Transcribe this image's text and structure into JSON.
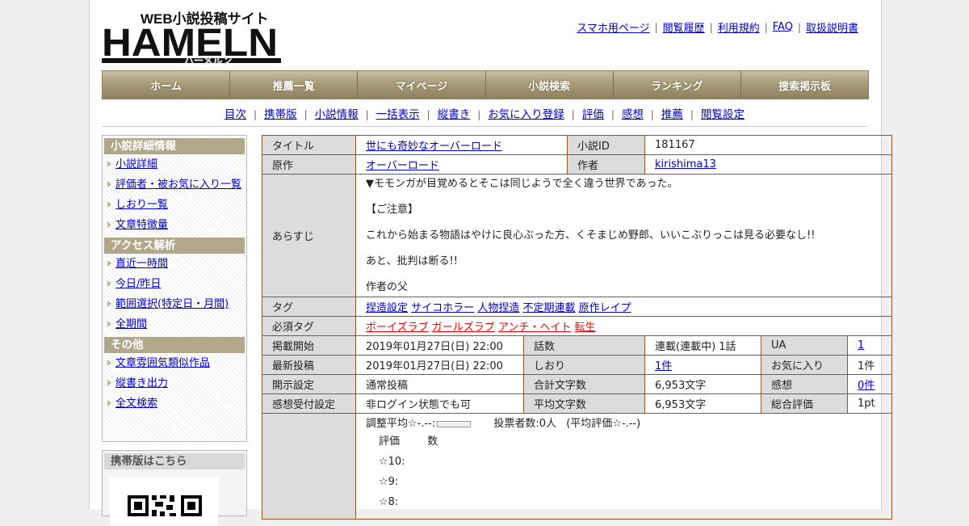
{
  "logo": {
    "main": "HAMELN",
    "tagline": "WEB小説投稿サイト",
    "kana": "ハーメルン"
  },
  "top_links": [
    "スマホ用ページ",
    "閲覧履歴",
    "利用規約",
    "FAQ",
    "取扱説明書"
  ],
  "main_nav": [
    "ホーム",
    "推薦一覧",
    "マイページ",
    "小説検索",
    "ランキング",
    "捜索掲示板"
  ],
  "sub_nav": [
    "目次",
    "携帯版",
    "小説情報",
    "一括表示",
    "縦書き",
    "お気に入り登録",
    "評価",
    "感想",
    "推薦",
    "閲覧設定"
  ],
  "sidebar": {
    "sections": [
      {
        "title": "小説詳細情報",
        "items": [
          "小説詳細",
          "評価者・被お気に入り一覧",
          "しおり一覧",
          "文章特徴量"
        ]
      },
      {
        "title": "アクセス解析",
        "items": [
          "直近一時間",
          "今日/昨日",
          "範囲選択(特定日・月間)",
          "全期間"
        ]
      },
      {
        "title": "その他",
        "items": [
          "文章雰囲気類似作品",
          "縦書き出力",
          "全文検索"
        ]
      }
    ],
    "mobile_title": "携帯版はこちら"
  },
  "info": {
    "title_label": "タイトル",
    "title_value": "世にも奇妙なオーバーロード",
    "novel_id_label": "小説ID",
    "novel_id_value": "181167",
    "original_label": "原作",
    "original_value": "オーバーロード",
    "author_label": "作者",
    "author_value": "kirishima13",
    "synopsis_label": "あらすじ",
    "synopsis": [
      "▼モモンガが目覚めるとそこは同じようで全く違う世界であった。",
      "【ご注意】",
      "これから始まる物語はやけに良心ぶった方、くそまじめ野郎、いいこぶりっこは見る必要なし!!",
      "あと、批判は断る!!",
      "作者の父"
    ],
    "tags_label": "タグ",
    "tags": [
      "捏造設定",
      "サイコホラー",
      "人物捏造",
      "不定期連載",
      "原作レイプ"
    ],
    "required_tags_label": "必須タグ",
    "required_tags": [
      "ボーイズラブ",
      "ガールズラブ",
      "アンチ・ヘイト",
      "転生"
    ],
    "rows": [
      [
        "掲載開始",
        "2019年01月27日(日) 22:00",
        "話数",
        "連載(連載中) 1話",
        "UA",
        "1"
      ],
      [
        "最新投稿",
        "2019年01月27日(日) 22:00",
        "しおり",
        "1件",
        "お気に入り",
        "1件"
      ],
      [
        "開示設定",
        "通常投稿",
        "合計文字数",
        "6,953文字",
        "感想",
        "0件"
      ],
      [
        "感想受付設定",
        "非ログイン状態でも可",
        "平均文字数",
        "6,953文字",
        "総合評価",
        "1pt"
      ]
    ],
    "rating": {
      "avg_label": "調整平均☆-.--:",
      "voters": "投票者数:0人",
      "avg_eval": "(平均評価☆-.--)",
      "col_eval": "評価",
      "col_count": "数",
      "stars": [
        "☆10:",
        "☆9:",
        "☆8:"
      ]
    }
  }
}
